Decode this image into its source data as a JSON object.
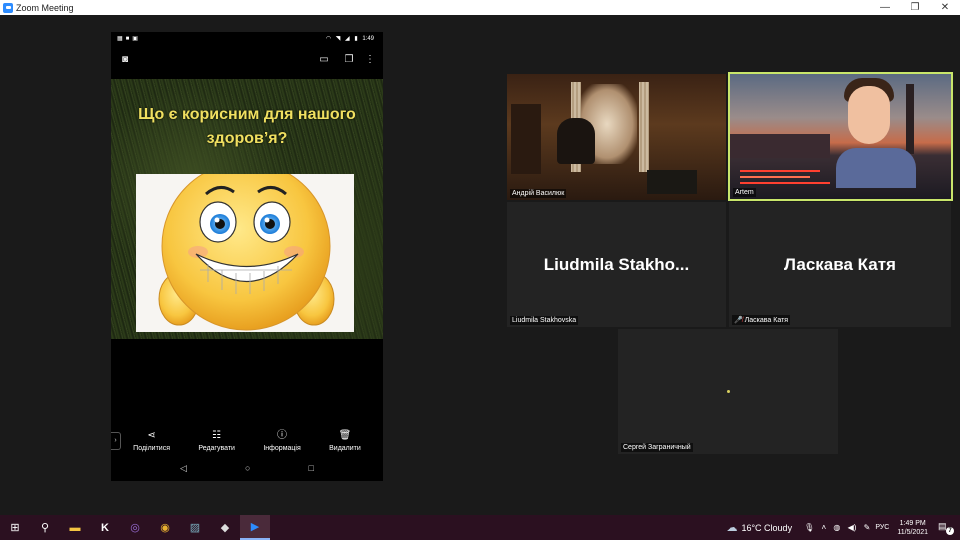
{
  "window": {
    "title": "Zoom Meeting",
    "controls": [
      "—",
      "❐",
      "✕"
    ]
  },
  "phone": {
    "status_time": "1:49",
    "caption_line1": "Що є корисним для нашого",
    "caption_line2": "здоров’я?",
    "actions": [
      {
        "icon": "share-icon",
        "glyph": "⋖",
        "label": "Поділитися"
      },
      {
        "icon": "sliders-icon",
        "glyph": "☷",
        "label": "Редагувати"
      },
      {
        "icon": "info-icon",
        "glyph": "ⓘ",
        "label": "Інформація"
      },
      {
        "icon": "trash-icon",
        "glyph": "🗑",
        "label": "Видалити"
      }
    ]
  },
  "participants": [
    {
      "name": "Андрій Василюк"
    },
    {
      "name": "Artem"
    },
    {
      "name": "Liudmila Stakhovska",
      "display": "Liudmila  Stakho..."
    },
    {
      "name": "Ласкава Катя",
      "display": "Ласкава Катя"
    },
    {
      "name": "Сергей Заграничный"
    }
  ],
  "taskbar": {
    "weather": "16°C  Cloudy",
    "language": "РУС",
    "time": "1:49 PM",
    "date": "11/5/2021",
    "notifications": "7"
  }
}
